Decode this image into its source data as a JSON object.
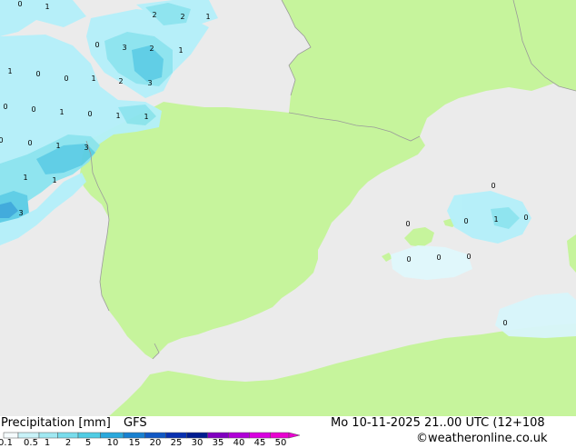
{
  "map": {
    "colors": {
      "sea": "#ebebeb",
      "land": "#c6f49c",
      "border": "#9a9a9a",
      "coast": "#a8a8a8",
      "precip_light": "#b4f0fa",
      "precip_mid": "#8be4f0",
      "precip_strong": "#5acde6",
      "precip_heavy": "#3aa8dc"
    },
    "labels": [
      "0",
      "1",
      "2",
      "2",
      "1",
      "0",
      "3",
      "2",
      "1",
      "1",
      "0",
      "1",
      "2",
      "3",
      "0",
      "0",
      "1",
      "0",
      "1",
      "1",
      "0",
      "0",
      "1",
      "3",
      "1",
      "1",
      "3",
      "0",
      "0",
      "1",
      "0",
      "0",
      "0",
      "0",
      "0",
      "0",
      "0"
    ]
  },
  "footer": {
    "title": "Precipitation [mm]",
    "model": "GFS",
    "datetime": "Mo 10-11-2025 21..00 UTC (12+108",
    "credit": "©weatheronline.co.uk",
    "legend_ticks": [
      "0.1",
      "0.5",
      "1",
      "2",
      "5",
      "10",
      "15",
      "20",
      "25",
      "30",
      "35",
      "40",
      "45",
      "50"
    ],
    "legend_colors": [
      "#f5fbfd",
      "#c8f2f8",
      "#a0e8f2",
      "#78dcec",
      "#50cce4",
      "#2aa8dc",
      "#1880d0",
      "#1058c4",
      "#0830b0",
      "#001c90",
      "#8000c0",
      "#b000d8",
      "#d800e0",
      "#e800d0"
    ]
  }
}
